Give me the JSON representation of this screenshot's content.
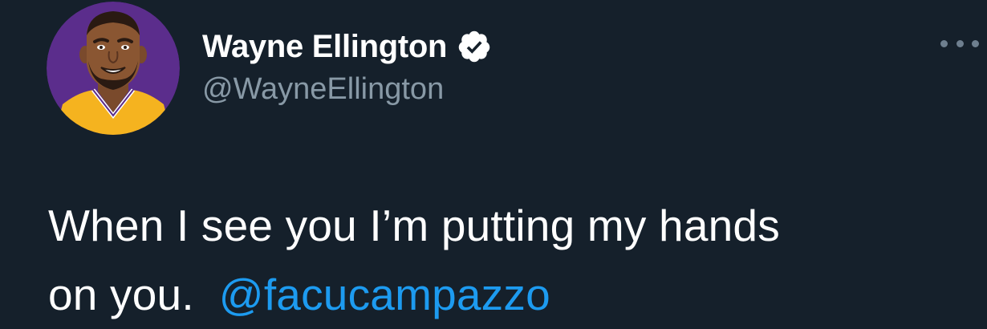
{
  "author": {
    "display_name": "Wayne Ellington",
    "handle": "@WayneEllington",
    "verified_icon": "verified-badge-icon",
    "avatar_icon": "cartoon-avatar"
  },
  "tweet": {
    "text_line1": "When I see you I’m putting my hands",
    "text_line2": "on you.",
    "mention": "@facucampazzo"
  },
  "menu": {
    "more_icon": "ellipsis-icon"
  },
  "colors": {
    "background": "#15202b",
    "text": "#ffffff",
    "secondary_text": "#8899a6",
    "link": "#1d9bf0",
    "avatar_bg": "#5b2d8c",
    "jersey": "#f5b31f"
  }
}
